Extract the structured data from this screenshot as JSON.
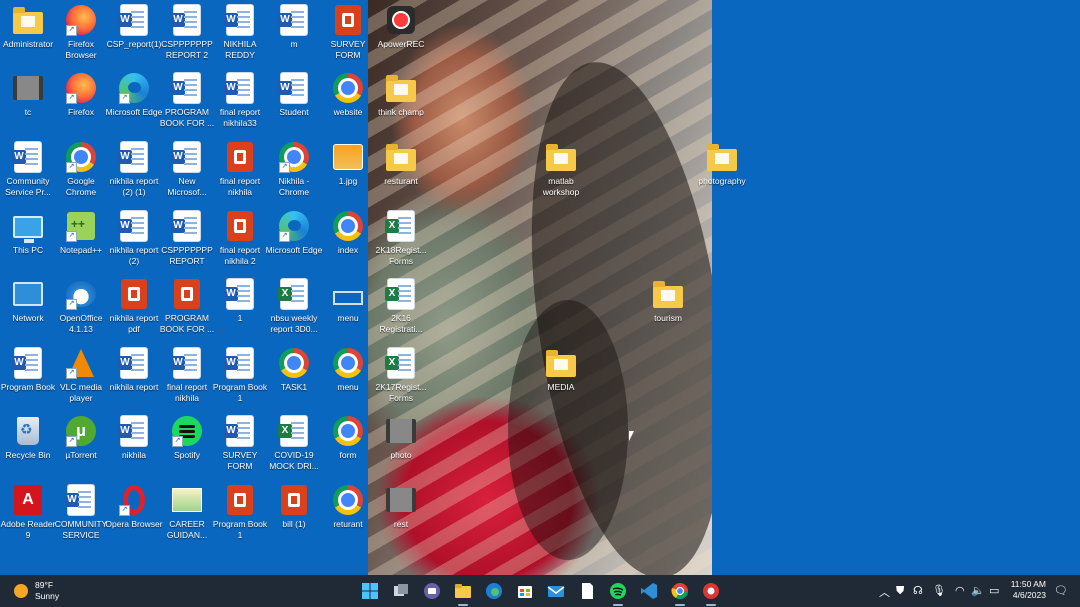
{
  "desktop": {
    "icons": [
      {
        "label": "Administrator",
        "type": "folder"
      },
      {
        "label": "Firefox Browser",
        "type": "firefox"
      },
      {
        "label": "CSP_report(1)",
        "type": "word"
      },
      {
        "label": "CSPPPPPPP REPORT 2",
        "type": "word"
      },
      {
        "label": "NIKHILA REDDY",
        "type": "word"
      },
      {
        "label": "m",
        "type": "word"
      },
      {
        "label": "SURVEY FORM",
        "type": "pptx"
      },
      {
        "label": "ApowerREC",
        "type": "rec"
      },
      {
        "label": "tc",
        "type": "video"
      },
      {
        "label": "Firefox",
        "type": "firefox"
      },
      {
        "label": "Microsoft Edge",
        "type": "edge"
      },
      {
        "label": "PROGRAM BOOK FOR ...",
        "type": "word"
      },
      {
        "label": "final report nikhila33",
        "type": "word"
      },
      {
        "label": "Student",
        "type": "word"
      },
      {
        "label": "website",
        "type": "chrome"
      },
      {
        "label": "think champ",
        "type": "folder"
      },
      {
        "label": "Community Service Pr...",
        "type": "word"
      },
      {
        "label": "Google Chrome",
        "type": "chrome"
      },
      {
        "label": "nikhila report (2) (1)",
        "type": "word"
      },
      {
        "label": "New Microsof...",
        "type": "word"
      },
      {
        "label": "final report nikhila",
        "type": "pptx"
      },
      {
        "label": "Nikhila - Chrome",
        "type": "chrome"
      },
      {
        "label": "1.jpg",
        "type": "img1"
      },
      {
        "label": "resturant",
        "type": "folder"
      },
      {
        "label": "matlab workshop",
        "type": "folder"
      },
      {
        "label": "photography",
        "type": "folder"
      },
      {
        "label": "This PC",
        "type": "monitor"
      },
      {
        "label": "Notepad++",
        "type": "notepadpp"
      },
      {
        "label": "nikhila report (2)",
        "type": "word"
      },
      {
        "label": "CSPPPPPPP REPORT",
        "type": "word"
      },
      {
        "label": "final report nikhila 2",
        "type": "pptx"
      },
      {
        "label": "Microsoft Edge",
        "type": "edge"
      },
      {
        "label": "index",
        "type": "chrome"
      },
      {
        "label": "2K18Regist... Forms",
        "type": "excel"
      },
      {
        "label": "Network",
        "type": "network"
      },
      {
        "label": "OpenOffice 4.1.13",
        "type": "openoffice"
      },
      {
        "label": "nikhila report pdf",
        "type": "pptx"
      },
      {
        "label": "PROGRAM BOOK FOR ...",
        "type": "pptx"
      },
      {
        "label": "1",
        "type": "word"
      },
      {
        "label": "nbsu weekly report 3D0...",
        "type": "excel"
      },
      {
        "label": "menu",
        "type": "menuico"
      },
      {
        "label": "2K16 Registrati...",
        "type": "excel"
      },
      {
        "label": "tourism",
        "type": "folder"
      },
      {
        "label": "Program Book",
        "type": "word"
      },
      {
        "label": "VLC media player",
        "type": "vlc"
      },
      {
        "label": "nikhila report",
        "type": "word"
      },
      {
        "label": "final report nikhila",
        "type": "word"
      },
      {
        "label": "Program Book 1",
        "type": "word"
      },
      {
        "label": "TASK1",
        "type": "chrome"
      },
      {
        "label": "menu",
        "type": "chrome"
      },
      {
        "label": "2K17Regist... Forms",
        "type": "excel"
      },
      {
        "label": "MEDIA",
        "type": "folder"
      },
      {
        "label": "Recycle Bin",
        "type": "recycle"
      },
      {
        "label": "µTorrent",
        "type": "utorrent"
      },
      {
        "label": "nikhila",
        "type": "word"
      },
      {
        "label": "Spotify",
        "type": "spotify"
      },
      {
        "label": "SURVEY FORM",
        "type": "word"
      },
      {
        "label": "COVID-19 MOCK DRI...",
        "type": "excel"
      },
      {
        "label": "form",
        "type": "chrome"
      },
      {
        "label": "photo",
        "type": "video"
      },
      {
        "label": "Adobe Reader 9",
        "type": "acrobat"
      },
      {
        "label": "COMMUNITY SERVICE PR...",
        "type": "word"
      },
      {
        "label": "Opera Browser",
        "type": "opera"
      },
      {
        "label": "CAREER GUIDAN...",
        "type": "career"
      },
      {
        "label": "Program Book 1",
        "type": "pptx"
      },
      {
        "label": "bill (1)",
        "type": "pptx"
      },
      {
        "label": "returant",
        "type": "chrome"
      },
      {
        "label": "rest",
        "type": "video"
      }
    ]
  },
  "taskbar": {
    "weather": {
      "temp": "89°F",
      "condition": "Sunny"
    },
    "apps": [
      "start-icon",
      "task-view-icon",
      "chat-icon",
      "file-explorer-icon",
      "edge-icon",
      "store-icon",
      "mail-icon",
      "notepad-icon",
      "spotify-icon",
      "vscode-icon",
      "chrome-icon",
      "apowerrec-icon"
    ],
    "time": "11:50 AM",
    "date": "4/6/2023"
  }
}
